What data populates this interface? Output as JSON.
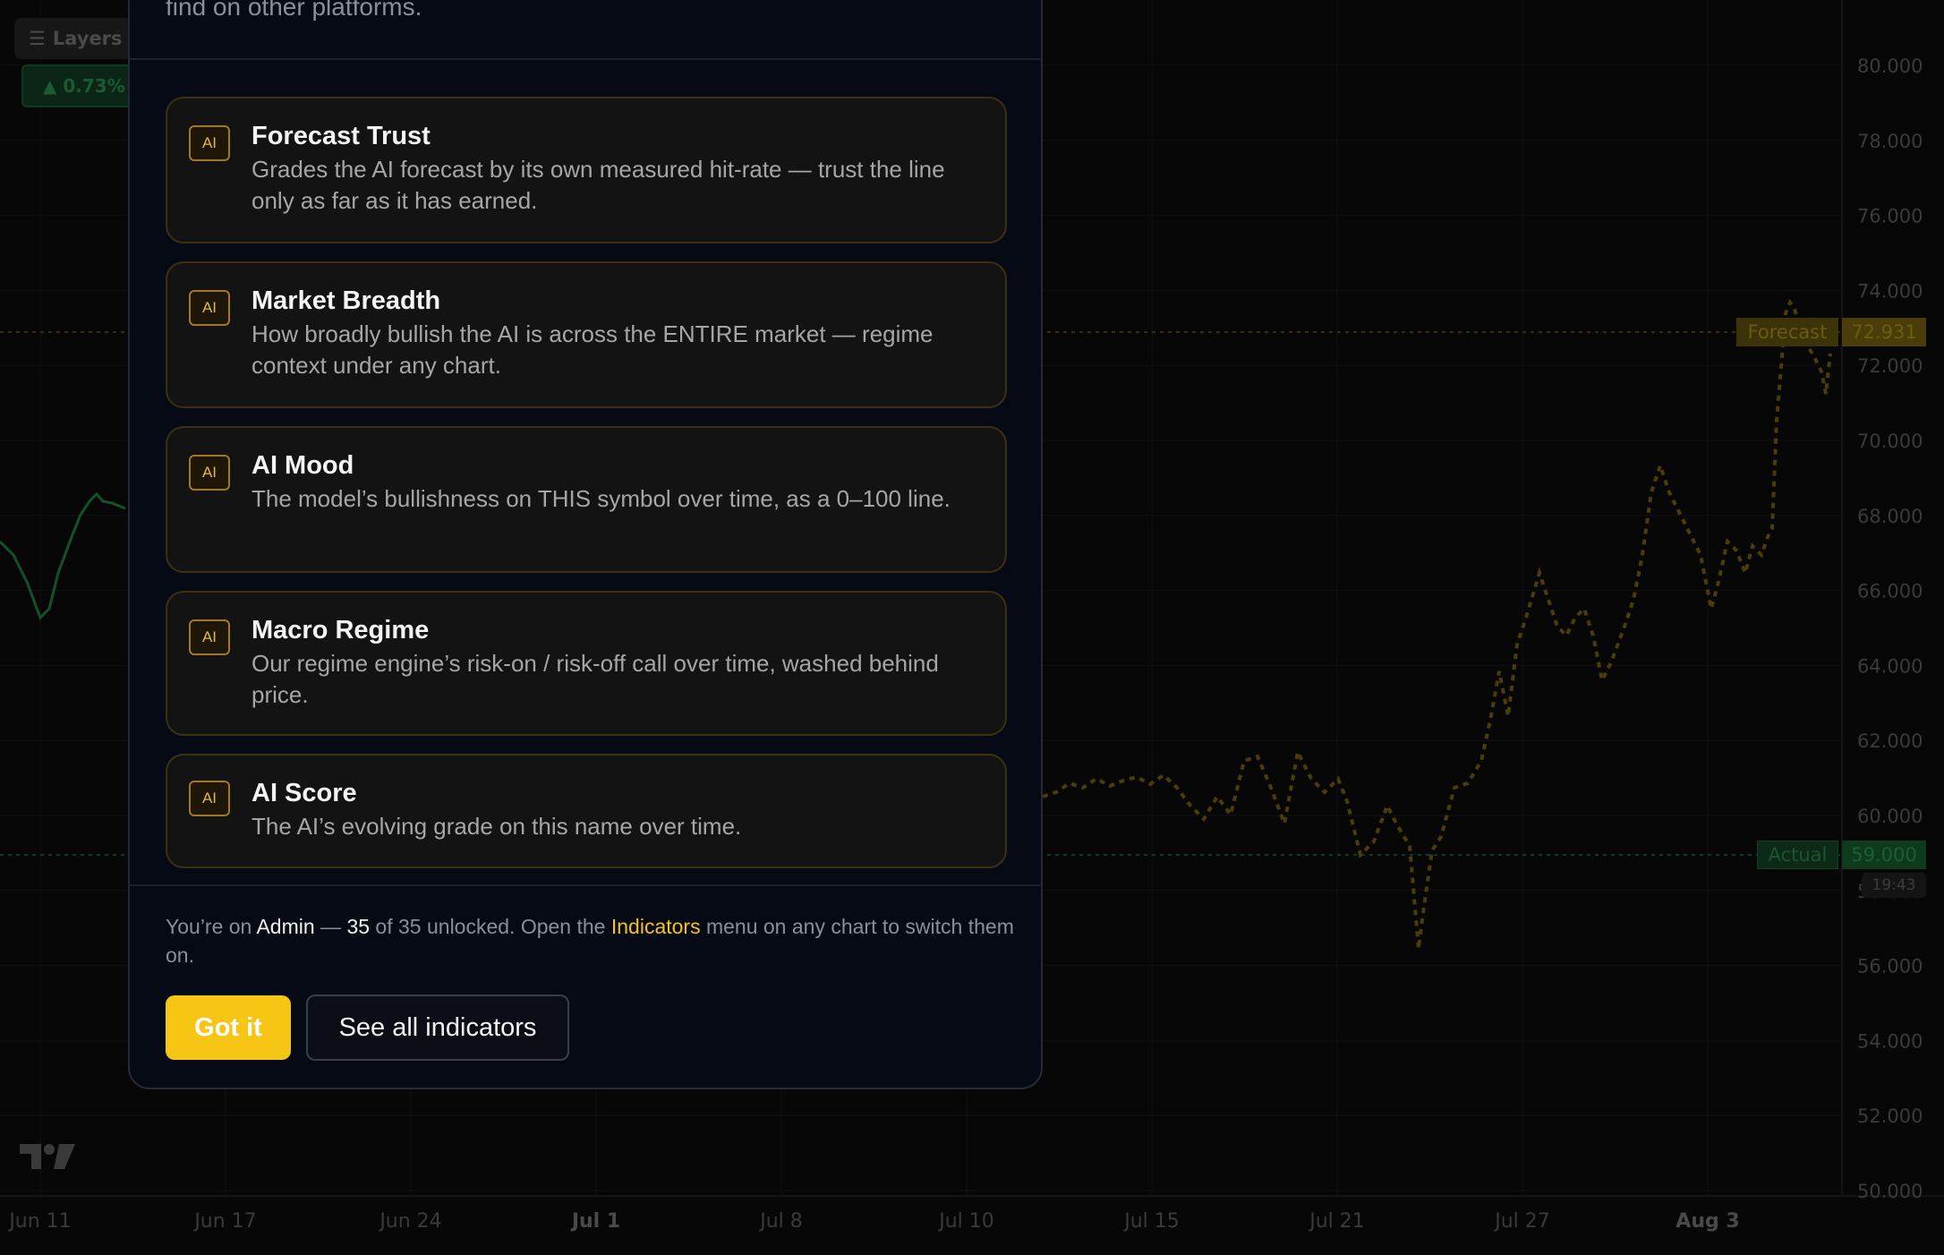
{
  "chart": {
    "layers_label": "Layers",
    "change_badge": "▲ 0.73%",
    "y_axis_ticks": [
      "80.000",
      "78.000",
      "76.000",
      "74.000",
      "72.000",
      "70.000",
      "68.000",
      "66.000",
      "64.000",
      "62.000",
      "60.000",
      "58.000",
      "56.000",
      "54.000",
      "52.000",
      "50.000"
    ],
    "x_axis_ticks": [
      "Jun 11",
      "Jun 17",
      "Jun 24",
      "Jul 1",
      "Jul 8",
      "Jul 10",
      "Jul 15",
      "Jul 21",
      "Jul 27",
      "Aug 3"
    ],
    "bold_x_ticks": [
      "Jul 1",
      "Aug 3"
    ],
    "forecast_label": "Forecast",
    "forecast_value": "72.931",
    "actual_label": "Actual",
    "actual_value": "59.000",
    "timer": "19:43",
    "colors": {
      "forecast": "#4a3d09",
      "actual": "#0e3a1e",
      "background": "#070707"
    }
  },
  "modal": {
    "intro_text": "find on other platforms.",
    "badge_text": "AI",
    "cards": [
      {
        "title": "Forecast Trust",
        "desc": "Grades the AI forecast by its own measured hit-rate — trust the line only as far as it has earned."
      },
      {
        "title": "Market Breadth",
        "desc": "How broadly bullish the AI is across the ENTIRE market — regime context under any chart."
      },
      {
        "title": "AI Mood",
        "desc": "The model’s bullishness on THIS symbol over time, as a 0–100 line."
      },
      {
        "title": "Macro Regime",
        "desc": "Our regime engine’s risk-on / risk-off call over time, washed behind price."
      },
      {
        "title": "AI Score",
        "desc": "The AI’s evolving grade on this name over time."
      }
    ],
    "footer": {
      "prefix": "You’re on ",
      "plan": "Admin",
      "dash": " — ",
      "unlocked": "35",
      "mid": " of 35 unlocked. Open the ",
      "menu": "Indicators",
      "suffix": " menu on any chart to switch them on."
    },
    "primary_button": "Got it",
    "secondary_button": "See all indicators",
    "colors": {
      "accent": "#f7c614",
      "card_border": "#3e2f13",
      "badge_border": "#a37a1b"
    }
  }
}
